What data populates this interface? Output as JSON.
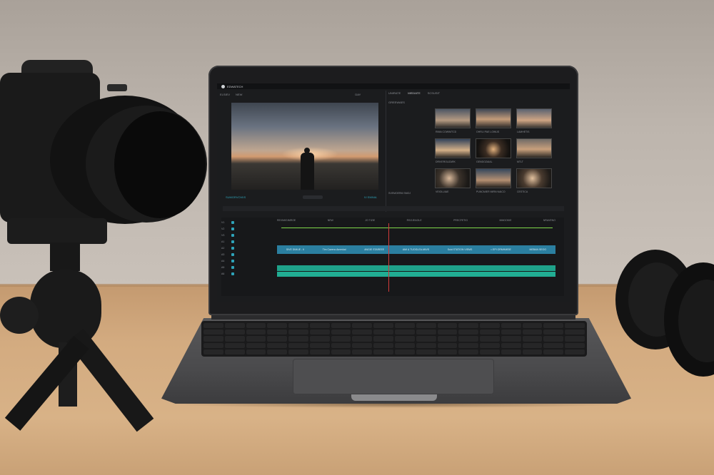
{
  "editor": {
    "app_title": "EDWATECH",
    "menu": [
      "ELSIEV",
      "NEW",
      "DAY"
    ],
    "viewer_caption_left": "SUMORVOVIIS",
    "viewer_caption_right": "IV EMNIA",
    "media_tabs": [
      "UNIRATE",
      "MEDIATE",
      "SCSUSIT"
    ],
    "media_label": "GREEWAES",
    "media_footer": "SVEMOERM  SMOJ",
    "thumbnails": [
      "RIMA   COWIMTCD",
      "OHRLI PAE LOWUS",
      "LAMHETIS",
      "DRIVEROUZARK",
      "GENDOZAIAL",
      "MTLT",
      "VEIOLUIAE",
      "PUNCMIER MIRN NAICO",
      "CESTICA"
    ],
    "track_labels": [
      "V1",
      "V2",
      "V3",
      "A1",
      "A2",
      "A3",
      "A4",
      "A5",
      "A6"
    ],
    "ruler_labels": [
      "REVIMIGIMROE",
      "NEW",
      "JO TIZIE",
      "RSOJEAOLE",
      "PRECFETIG",
      "MMOOKIE",
      "NRAVENO"
    ],
    "clips": [
      "SIVE DIMUE - II",
      "Tim Cavenc Amevkal",
      "ANGIE STAREEE",
      "AMI & TUOGLEA ANVS",
      "Suid STATION VIEMS",
      "= EPI ORMHMEIE",
      "MEBAN SEOO"
    ]
  },
  "colors": {
    "accent": "#2ea3b8",
    "clip_video": "#2b7fa0",
    "clip_audio": "#1fa28a",
    "playhead": "#d23a3a",
    "marker_line": "#7fd84a"
  }
}
